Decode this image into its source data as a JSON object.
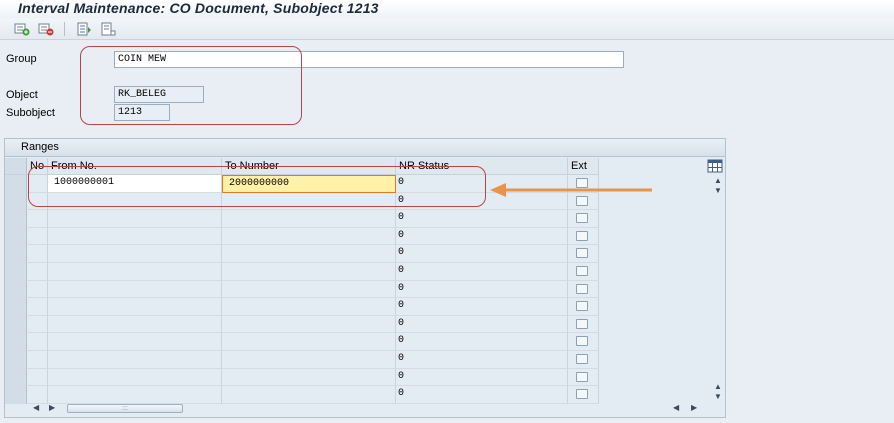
{
  "window": {
    "title": "Interval Maintenance: CO Document, Subobject 1213"
  },
  "toolbar": {
    "icons": [
      "insert-interval-icon",
      "delete-interval-icon",
      "status-change-icon",
      "no-range-icon"
    ]
  },
  "form": {
    "group_label": "Group",
    "group_value": "COIN MEW",
    "object_label": "Object",
    "object_value": "RK_BELEG",
    "subobject_label": "Subobject",
    "subobject_value": "1213"
  },
  "ranges": {
    "title": "Ranges",
    "columns": {
      "no": "No",
      "from": "From No.",
      "to": "To Number",
      "status": "NR Status",
      "ext": "Ext"
    },
    "rows": [
      {
        "no": "",
        "from": "1000000001",
        "to": "2000000000",
        "status": "0",
        "ext": false
      },
      {
        "no": "",
        "from": "",
        "to": "",
        "status": "0",
        "ext": false
      },
      {
        "no": "",
        "from": "",
        "to": "",
        "status": "0",
        "ext": false
      },
      {
        "no": "",
        "from": "",
        "to": "",
        "status": "0",
        "ext": false
      },
      {
        "no": "",
        "from": "",
        "to": "",
        "status": "0",
        "ext": false
      },
      {
        "no": "",
        "from": "",
        "to": "",
        "status": "0",
        "ext": false
      },
      {
        "no": "",
        "from": "",
        "to": "",
        "status": "0",
        "ext": false
      },
      {
        "no": "",
        "from": "",
        "to": "",
        "status": "0",
        "ext": false
      },
      {
        "no": "",
        "from": "",
        "to": "",
        "status": "0",
        "ext": false
      },
      {
        "no": "",
        "from": "",
        "to": "",
        "status": "0",
        "ext": false
      },
      {
        "no": "",
        "from": "",
        "to": "",
        "status": "0",
        "ext": false
      },
      {
        "no": "",
        "from": "",
        "to": "",
        "status": "0",
        "ext": false
      },
      {
        "no": "",
        "from": "",
        "to": "",
        "status": "0",
        "ext": false
      }
    ]
  },
  "colors": {
    "highlight_field": "#fff2a8",
    "annotation_red": "#b34747",
    "annotation_arrow": "#e8944a"
  }
}
